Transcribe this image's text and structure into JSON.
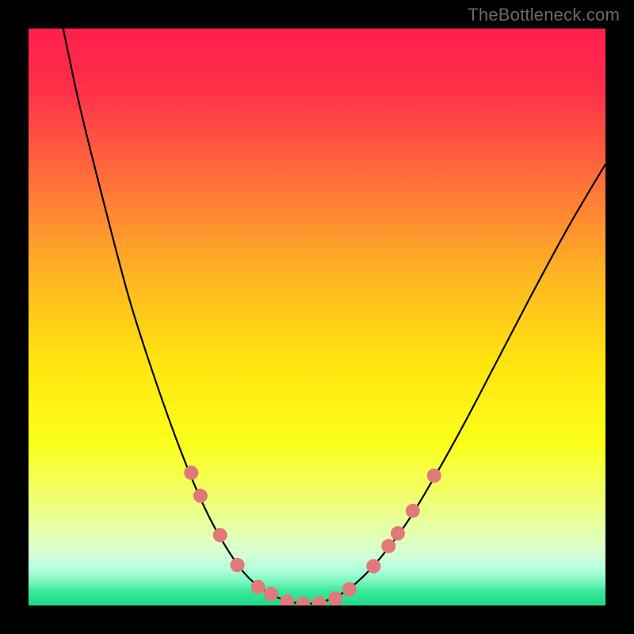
{
  "watermark": {
    "text": "TheBottleneck.com"
  },
  "gradient": {
    "stops": [
      {
        "offset": 0.0,
        "color": "#ff1f4e"
      },
      {
        "offset": 0.1,
        "color": "#ff2e49"
      },
      {
        "offset": 0.25,
        "color": "#ff6a3c"
      },
      {
        "offset": 0.42,
        "color": "#ffb224"
      },
      {
        "offset": 0.58,
        "color": "#ffe50f"
      },
      {
        "offset": 0.72,
        "color": "#fbff1a"
      },
      {
        "offset": 0.8,
        "color": "#f1ff63"
      },
      {
        "offset": 0.86,
        "color": "#e7ffa0"
      },
      {
        "offset": 0.905,
        "color": "#d9ffce"
      },
      {
        "offset": 0.935,
        "color": "#b7ffdf"
      },
      {
        "offset": 0.958,
        "color": "#7cf7c0"
      },
      {
        "offset": 0.975,
        "color": "#3ae99a"
      },
      {
        "offset": 1.0,
        "color": "#1fd884"
      }
    ]
  },
  "curve": {
    "stroke": "#000000",
    "stroke_width": 2.2,
    "points": [
      {
        "x": 0.06,
        "y": 0.0
      },
      {
        "x": 0.09,
        "y": 0.14
      },
      {
        "x": 0.13,
        "y": 0.3
      },
      {
        "x": 0.175,
        "y": 0.47
      },
      {
        "x": 0.22,
        "y": 0.61
      },
      {
        "x": 0.265,
        "y": 0.735
      },
      {
        "x": 0.305,
        "y": 0.83
      },
      {
        "x": 0.34,
        "y": 0.895
      },
      {
        "x": 0.375,
        "y": 0.945
      },
      {
        "x": 0.41,
        "y": 0.975
      },
      {
        "x": 0.445,
        "y": 0.991
      },
      {
        "x": 0.48,
        "y": 0.997
      },
      {
        "x": 0.515,
        "y": 0.992
      },
      {
        "x": 0.55,
        "y": 0.975
      },
      {
        "x": 0.585,
        "y": 0.945
      },
      {
        "x": 0.62,
        "y": 0.905
      },
      {
        "x": 0.66,
        "y": 0.85
      },
      {
        "x": 0.705,
        "y": 0.775
      },
      {
        "x": 0.755,
        "y": 0.685
      },
      {
        "x": 0.81,
        "y": 0.58
      },
      {
        "x": 0.87,
        "y": 0.465
      },
      {
        "x": 0.935,
        "y": 0.345
      },
      {
        "x": 1.0,
        "y": 0.235
      }
    ]
  },
  "markers": {
    "fill": "#e07a7a",
    "radius": 9,
    "points": [
      {
        "x": 0.282,
        "y": 0.77
      },
      {
        "x": 0.298,
        "y": 0.81
      },
      {
        "x": 0.332,
        "y": 0.878
      },
      {
        "x": 0.362,
        "y": 0.93
      },
      {
        "x": 0.398,
        "y": 0.968
      },
      {
        "x": 0.42,
        "y": 0.98
      },
      {
        "x": 0.448,
        "y": 0.993
      },
      {
        "x": 0.476,
        "y": 0.997
      },
      {
        "x": 0.504,
        "y": 0.996
      },
      {
        "x": 0.532,
        "y": 0.988
      },
      {
        "x": 0.556,
        "y": 0.972
      },
      {
        "x": 0.598,
        "y": 0.932
      },
      {
        "x": 0.624,
        "y": 0.897
      },
      {
        "x": 0.64,
        "y": 0.875
      },
      {
        "x": 0.666,
        "y": 0.836
      },
      {
        "x": 0.703,
        "y": 0.775
      }
    ]
  },
  "chart_data": {
    "type": "line",
    "series": [
      {
        "name": "bottleneck-curve",
        "x": [
          0.06,
          0.09,
          0.13,
          0.175,
          0.22,
          0.265,
          0.305,
          0.34,
          0.375,
          0.41,
          0.445,
          0.48,
          0.515,
          0.55,
          0.585,
          0.62,
          0.66,
          0.705,
          0.755,
          0.81,
          0.87,
          0.935,
          1.0
        ],
        "y": [
          1.0,
          0.86,
          0.7,
          0.53,
          0.39,
          0.265,
          0.17,
          0.105,
          0.055,
          0.025,
          0.009,
          0.003,
          0.008,
          0.025,
          0.055,
          0.095,
          0.15,
          0.225,
          0.315,
          0.42,
          0.535,
          0.655,
          0.765
        ]
      },
      {
        "name": "highlighted-points",
        "x": [
          0.282,
          0.298,
          0.332,
          0.362,
          0.398,
          0.42,
          0.448,
          0.476,
          0.504,
          0.532,
          0.556,
          0.598,
          0.624,
          0.64,
          0.666,
          0.703
        ],
        "y": [
          0.23,
          0.19,
          0.122,
          0.07,
          0.032,
          0.02,
          0.007,
          0.003,
          0.004,
          0.012,
          0.028,
          0.068,
          0.103,
          0.125,
          0.164,
          0.225
        ]
      }
    ],
    "xlabel": "",
    "ylabel": "",
    "xlim": [
      0,
      1
    ],
    "ylim": [
      0,
      1
    ],
    "title": "",
    "annotations": [
      {
        "text": "TheBottleneck.com",
        "pos": "top-right"
      }
    ]
  }
}
